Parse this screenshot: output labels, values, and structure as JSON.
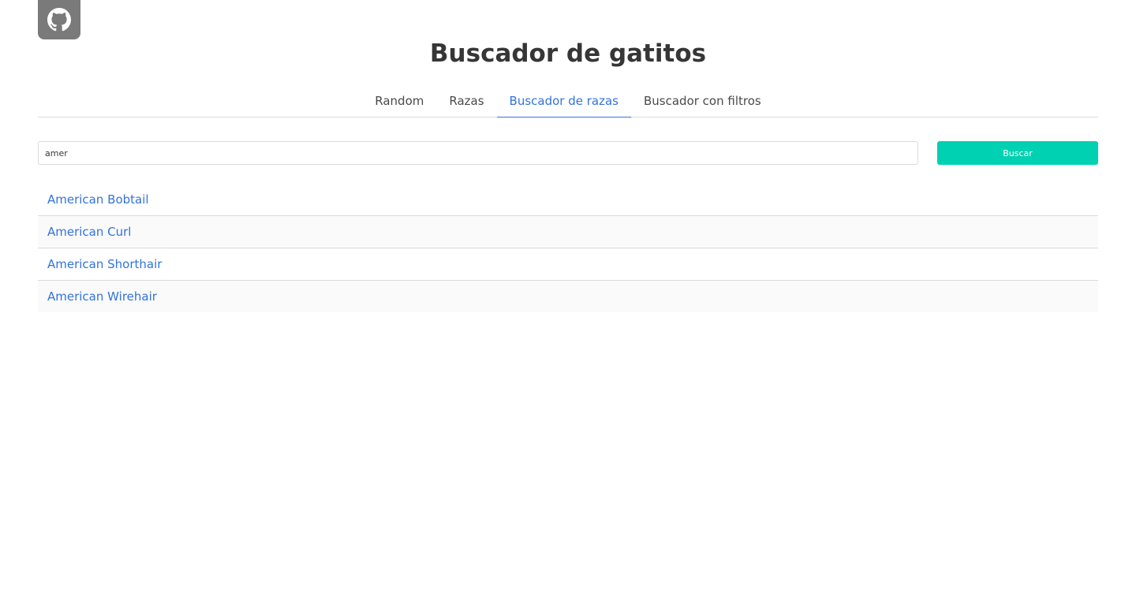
{
  "header": {
    "github_icon": "github-icon",
    "title": "Buscador de gatitos"
  },
  "tabs": [
    {
      "label": "Random",
      "active": false
    },
    {
      "label": "Razas",
      "active": false
    },
    {
      "label": "Buscador de razas",
      "active": true
    },
    {
      "label": "Buscador con filtros",
      "active": false
    }
  ],
  "search": {
    "value": "amer",
    "placeholder": "",
    "button_label": "Buscar"
  },
  "results": [
    "American Bobtail",
    "American Curl",
    "American Shorthair",
    "American Wirehair"
  ],
  "colors": {
    "accent": "#3273dc",
    "button": "#00d1b2",
    "github_bg": "#7a7a7a"
  }
}
